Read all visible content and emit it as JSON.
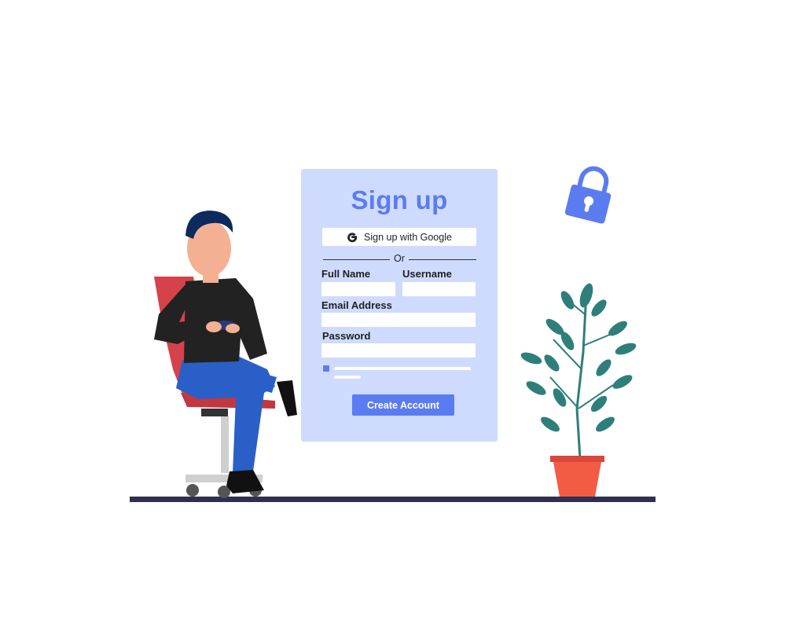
{
  "form": {
    "title": "Sign up",
    "google_label": "Sign up with Google",
    "or_label": "Or",
    "full_name_label": "Full Name",
    "username_label": "Username",
    "email_label": "Email Address",
    "password_label": "Password",
    "full_name_value": "",
    "username_value": "",
    "email_value": "",
    "password_value": "",
    "submit_label": "Create Account"
  },
  "icons": {
    "google": "google-g-icon",
    "lock": "padlock-icon"
  },
  "colors": {
    "accent": "#5b7cf0",
    "card_background": "#cfdbfe",
    "floor": "#2f3050",
    "pot": "#f25c44",
    "leaves": "#2e7f7a",
    "chair": "#d6424a",
    "jeans": "#2a5fc7",
    "sweater": "#222222",
    "skin": "#f4b092",
    "hair": "#0d2a5e"
  }
}
